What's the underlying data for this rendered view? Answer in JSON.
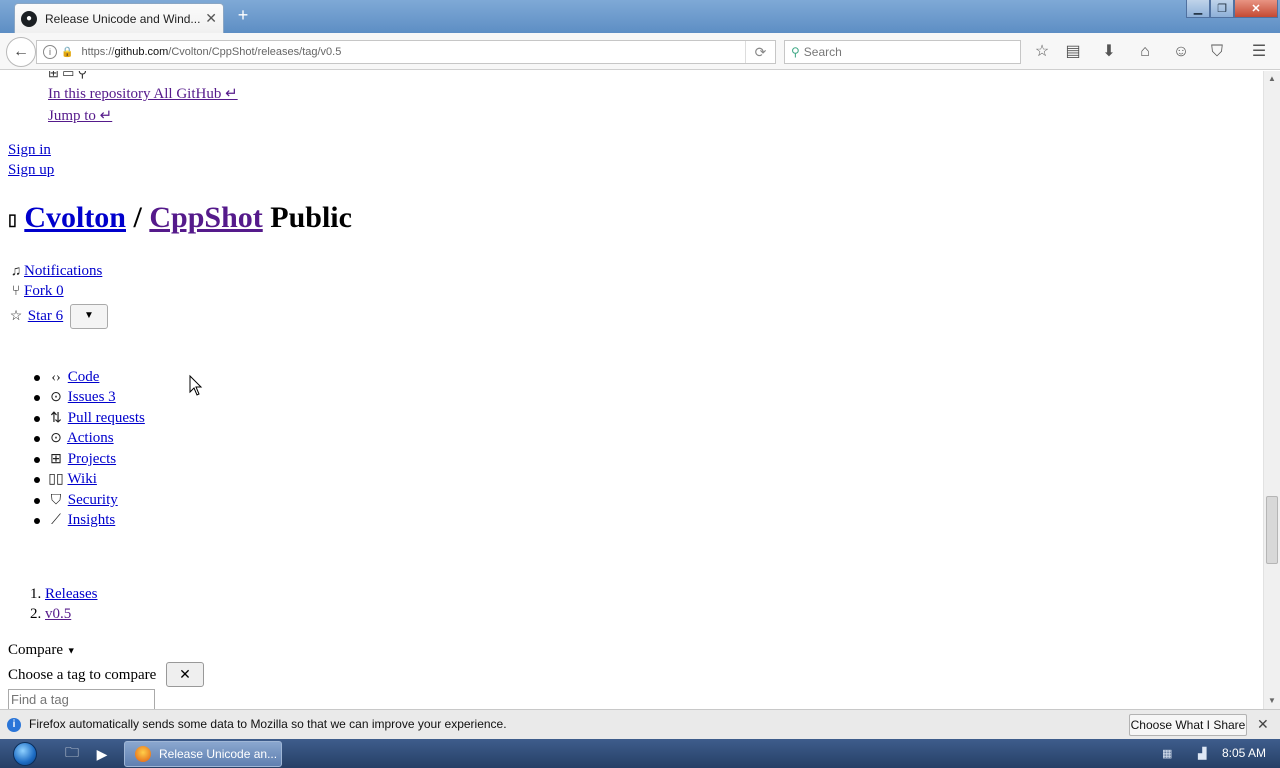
{
  "browser": {
    "tab_title": "Release Unicode and Wind...",
    "tab_close": "✕",
    "new_tab": "+",
    "url_prefix": "https://",
    "url_domain": "github.com",
    "url_path": "/Cvolton/CppShot/releases/tag/v0.5",
    "search_placeholder": "Search"
  },
  "page": {
    "search_scope_line": "In this repository All GitHub ↵",
    "jump_to": "Jump to ↵",
    "sign_in": "Sign in",
    "sign_up": "Sign up",
    "owner": "Cvolton",
    "separator": "/",
    "repo": "CppShot",
    "visibility": "Public",
    "notifications": "Notifications",
    "fork": "Fork 0",
    "star": "Star 6",
    "nav_items": [
      {
        "label": "Code",
        "icon": "code-icon"
      },
      {
        "label": "Issues 3",
        "icon": "issue-icon"
      },
      {
        "label": "Pull requests",
        "icon": "pull-request-icon"
      },
      {
        "label": "Actions",
        "icon": "actions-icon"
      },
      {
        "label": "Projects",
        "icon": "projects-icon"
      },
      {
        "label": "Wiki",
        "icon": "wiki-icon"
      },
      {
        "label": "Security",
        "icon": "shield-icon"
      },
      {
        "label": "Insights",
        "icon": "graph-icon"
      }
    ],
    "breadcrumb": [
      {
        "num": "1.",
        "label": "Releases"
      },
      {
        "num": "2.",
        "label": "v0.5"
      }
    ],
    "compare": "Compare",
    "compare_prompt": "Choose a tag to compare",
    "tag_placeholder": "Find a tag"
  },
  "notification": {
    "text": "Firefox automatically sends some data to Mozilla so that we can improve your experience.",
    "button": "Choose What I Share"
  },
  "taskbar": {
    "firefox_label": "Release Unicode an...",
    "clock": "8:05 AM"
  }
}
